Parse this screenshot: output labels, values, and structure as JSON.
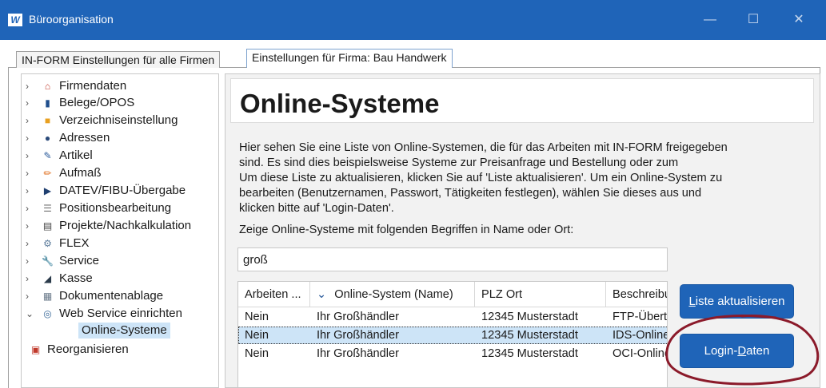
{
  "window": {
    "icon_text": "W",
    "title": "Büroorganisation",
    "controls": {
      "minimize": "—",
      "maximize": "☐",
      "close": "✕"
    }
  },
  "tabs": [
    {
      "label": "IN-FORM Einstellungen für alle Firmen"
    },
    {
      "label": "Einstellungen für Firma: Bau Handwerk"
    }
  ],
  "tree": {
    "items": [
      {
        "label": "Firmendaten",
        "icon": "home-icon",
        "glyph": "⌂",
        "color": "#c0392b",
        "chev": "›"
      },
      {
        "label": "Belege/OPOS",
        "icon": "document-icon",
        "glyph": "▮",
        "color": "#1f4e8c",
        "chev": "›"
      },
      {
        "label": "Verzeichniseinstellung",
        "icon": "folder-icon",
        "glyph": "■",
        "color": "#e8a020",
        "chev": "›"
      },
      {
        "label": "Adressen",
        "icon": "contacts-icon",
        "glyph": "●",
        "color": "#2b4a7a",
        "chev": "›"
      },
      {
        "label": "Artikel",
        "icon": "article-icon",
        "glyph": "✎",
        "color": "#2a5a9a",
        "chev": "›"
      },
      {
        "label": "Aufmaß",
        "icon": "pencil-icon",
        "glyph": "✏",
        "color": "#e07020",
        "chev": "›"
      },
      {
        "label": "DATEV/FIBU-Übergabe",
        "icon": "play-icon",
        "glyph": "▶",
        "color": "#1f3f70",
        "chev": "›"
      },
      {
        "label": "Positionsbearbeitung",
        "icon": "list-icon",
        "glyph": "☰",
        "color": "#707070",
        "chev": "›"
      },
      {
        "label": "Projekte/Nachkalkulation",
        "icon": "calculator-icon",
        "glyph": "▤",
        "color": "#404040",
        "chev": "›"
      },
      {
        "label": "FLEX",
        "icon": "gears-icon",
        "glyph": "⚙",
        "color": "#5a7a9a",
        "chev": "›"
      },
      {
        "label": "Service",
        "icon": "wrench-icon",
        "glyph": "🔧",
        "color": "#2a5a9a",
        "chev": "›"
      },
      {
        "label": "Kasse",
        "icon": "cash-register-icon",
        "glyph": "◢",
        "color": "#2a3a4a",
        "chev": "›"
      },
      {
        "label": "Dokumentenablage",
        "icon": "archive-icon",
        "glyph": "▦",
        "color": "#6a7a8a",
        "chev": "›"
      },
      {
        "label": "Web Service einrichten",
        "icon": "globe-icon",
        "glyph": "◎",
        "color": "#3a6a9a",
        "chev": "⌄"
      }
    ],
    "selected_child": {
      "label": "Online-Systeme"
    },
    "reorg": {
      "label": "Reorganisieren",
      "icon": "reorganize-icon",
      "glyph": "▣",
      "color": "#c0392b"
    }
  },
  "main": {
    "title": "Online-Systeme",
    "description": [
      "Hier sehen Sie eine Liste von Online-Systemen, die für das Arbeiten mit IN-FORM freigegeben",
      "sind. Es sind dies beispielsweise Systeme zur Preisanfrage und Bestellung oder zum",
      "Um diese Liste zu aktualisieren, klicken Sie auf 'Liste aktualisieren'. Um ein Online-System zu",
      "bearbeiten (Benutzernamen, Passwort, Tätigkeiten festlegen), wählen Sie dieses aus und",
      "klicken bitte auf 'Login-Daten'."
    ],
    "filter_label": "Zeige Online-Systeme mit folgenden Begriffen in Name oder Ort:",
    "filter_value": "groß",
    "table": {
      "columns": [
        "Arbeiten ...",
        "Online-System (Name)",
        "PLZ Ort",
        "Beschreibung"
      ],
      "sort_indicator": "⌄",
      "rows": [
        [
          "Nein",
          "Ihr Großhändler",
          "12345 Musterstadt",
          "FTP-Übertragung"
        ],
        [
          "Nein",
          "Ihr Großhändler",
          "12345 Musterstadt",
          "IDS-Online"
        ],
        [
          "Nein",
          "Ihr Großhändler",
          "12345 Musterstadt",
          "OCI-Online"
        ]
      ],
      "selected_row": 1
    },
    "buttons": {
      "refresh_accel": "L",
      "refresh_rest": "iste aktualisieren",
      "login_pre": "Login-",
      "login_accel": "D",
      "login_rest": "aten"
    }
  },
  "colors": {
    "accent": "#1f64b8",
    "selection": "#cde4f7",
    "annotation": "#8b1a2a"
  }
}
